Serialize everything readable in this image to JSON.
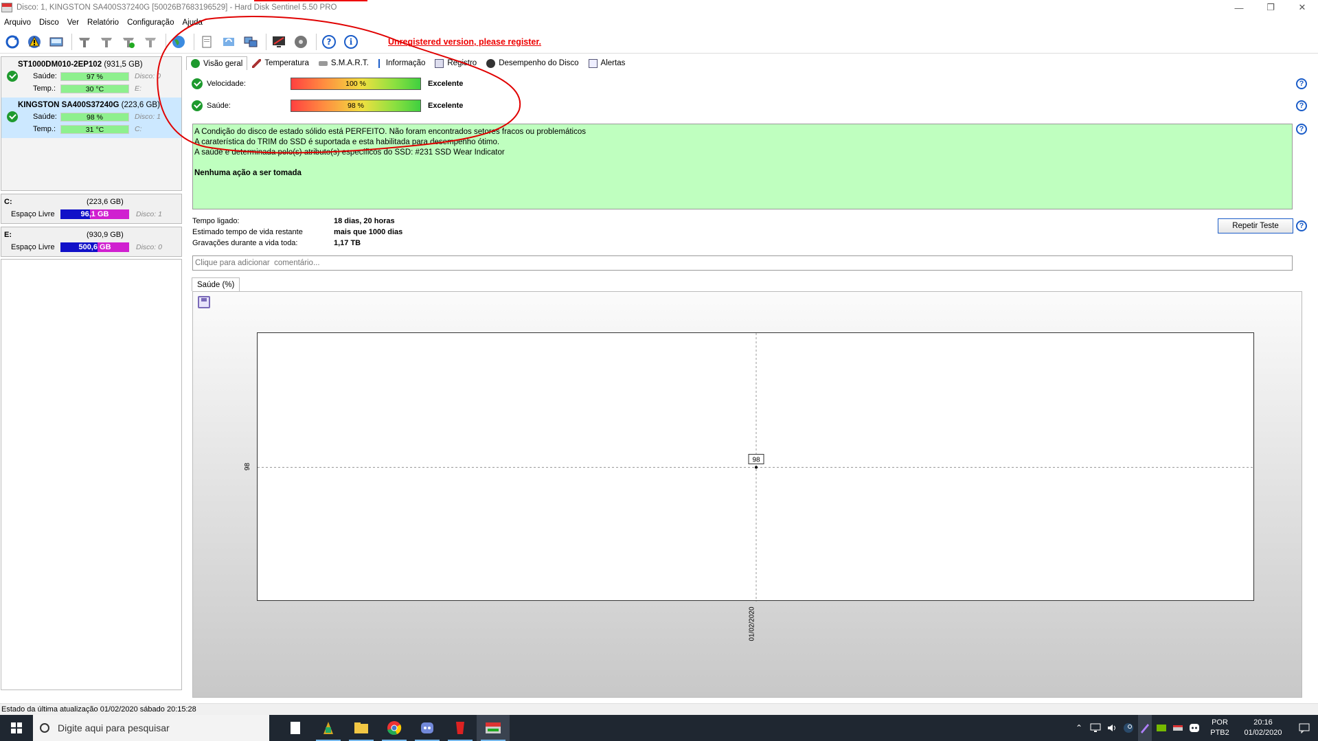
{
  "window": {
    "title": "Disco: 1, KINGSTON SA400S37240G [50026B7683196529]  -  Hard Disk Sentinel 5.50 PRO"
  },
  "menu": [
    "Arquivo",
    "Disco",
    "Ver",
    "Relatório",
    "Configuração",
    "Ajuda"
  ],
  "toolbar": {
    "register_text": "Unregistered version, please register."
  },
  "disks": [
    {
      "name": "ST1000DM010-2EP102",
      "size": "(931,5 GB)",
      "health_label": "Saúde:",
      "health": "97 %",
      "health_extra": "Disco: 0",
      "temp_label": "Temp.:",
      "temp": "30 °C",
      "temp_extra": "E:"
    },
    {
      "name": "KINGSTON SA400S37240G",
      "size": "(223,6 GB)",
      "health_label": "Saúde:",
      "health": "98 %",
      "health_extra": "Disco: 1",
      "temp_label": "Temp.:",
      "temp": "31 °C",
      "temp_extra": "C:"
    }
  ],
  "volumes": [
    {
      "letter": "C:",
      "size": "(223,6 GB)",
      "free_label": "Espaço Livre",
      "free": "96,1 GB",
      "free_fraction": 0.43,
      "disk": "Disco: 1"
    },
    {
      "letter": "E:",
      "size": "(930,9 GB)",
      "free_label": "Espaço Livre",
      "free": "500,6 GB",
      "free_fraction": 0.54,
      "disk": "Disco: 0"
    }
  ],
  "tabs": [
    "Visão geral",
    "Temperatura",
    "S.M.A.R.T.",
    "Informação",
    "Registro",
    "Desempenho do Disco",
    "Alertas"
  ],
  "overview": {
    "speed_label": "Velocidade:",
    "speed_value": "100 %",
    "speed_verdict": "Excelente",
    "health_label": "Saúde:",
    "health_value": "98 %",
    "health_verdict": "Excelente",
    "report_lines": [
      "A Condição do disco de estado sólido está PERFEITO. Não foram encontrados setores fracos ou problemáticos",
      "A caraterística do TRIM do SSD é suportada e esta habilitada para desempenho ótimo.",
      "A saúde e determinada pelo(s) atributo(s) específicos do SSD: #231 SSD Wear Indicator"
    ],
    "report_action": "Nenhuma ação a ser tomada",
    "stats": [
      {
        "label": "Tempo ligado:",
        "value": "18 dias, 20 horas"
      },
      {
        "label": "Estimado tempo de vida restante",
        "value": "mais que 1000 dias"
      },
      {
        "label": "Gravações durante a vida toda:",
        "value": "1,17 TB"
      }
    ],
    "retest_label": "Repetir Teste",
    "comment_placeholder": "Clique para adicionar  comentário...",
    "help_glyph": "?"
  },
  "chart_tab": "Saúde (%)",
  "chart_data": {
    "type": "line",
    "x": [
      "01/02/2020"
    ],
    "series": [
      {
        "values": [
          98
        ]
      }
    ],
    "x_tick_labels": [
      "01/02/2020"
    ],
    "y_tick_labels": [
      "98"
    ],
    "data_labels": [
      "98"
    ],
    "grid": true
  },
  "statusbar": {
    "text": "Estado da última atualização 01/02/2020 sábado 20:15:28"
  },
  "taskbar": {
    "search_placeholder": "Digite aqui para pesquisar",
    "lang_top": "POR",
    "lang_bottom": "PTB2",
    "time": "20:16",
    "date": "01/02/2020"
  },
  "colors": {
    "accent_red": "#e00000",
    "health_green": "#8ef08e",
    "report_bg": "#bfffbf",
    "selected_bg": "#cce8ff",
    "free_fill": "#1010c8",
    "free_bg": "#d020d0"
  }
}
